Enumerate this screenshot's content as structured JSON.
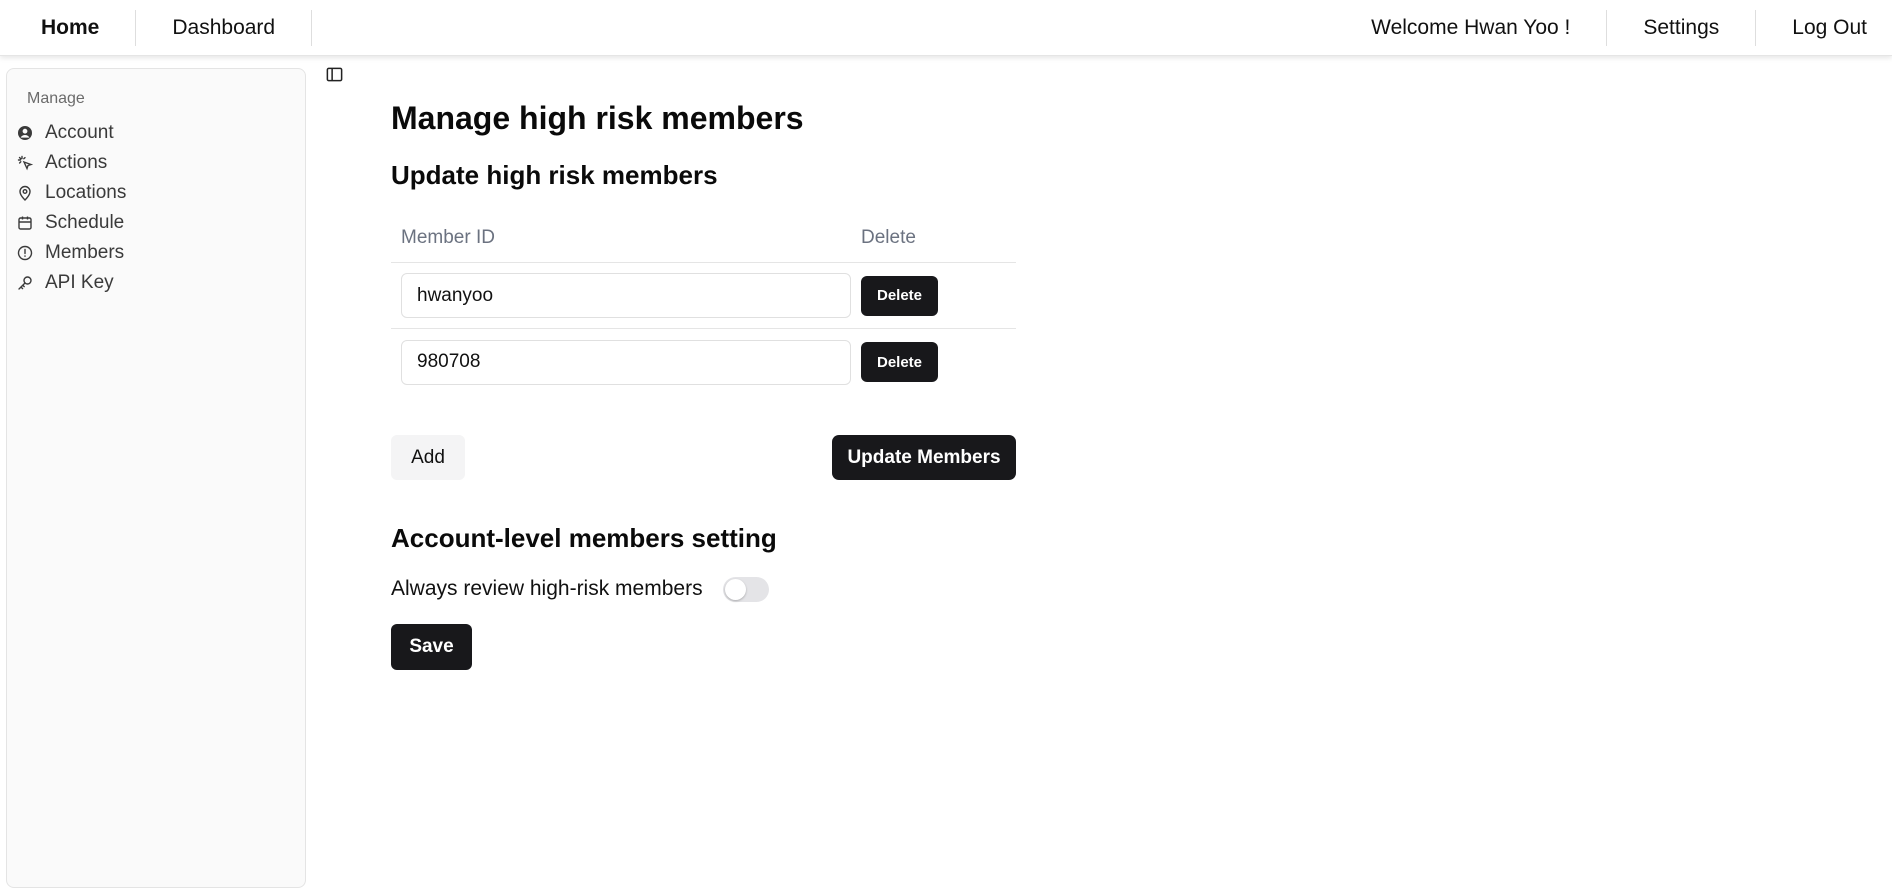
{
  "nav": {
    "home": "Home",
    "dashboard": "Dashboard",
    "welcome": "Welcome Hwan Yoo !",
    "settings": "Settings",
    "logout": "Log Out"
  },
  "sidebar": {
    "group_label": "Manage",
    "items": [
      {
        "label": "Account",
        "icon": "user-circle-icon"
      },
      {
        "label": "Actions",
        "icon": "pointer-click-icon"
      },
      {
        "label": "Locations",
        "icon": "map-pin-icon"
      },
      {
        "label": "Schedule",
        "icon": "calendar-icon"
      },
      {
        "label": "Members",
        "icon": "alert-circle-icon"
      },
      {
        "label": "API Key",
        "icon": "key-icon"
      }
    ],
    "toggle_icon": "sidebar-toggle-icon"
  },
  "main": {
    "page_title": "Manage high risk members",
    "update_section_title": "Update high risk members",
    "table": {
      "headers": [
        "Member ID",
        "Delete"
      ],
      "rows": [
        {
          "member_id": "hwanyoo",
          "delete_label": "Delete"
        },
        {
          "member_id": "980708",
          "delete_label": "Delete"
        }
      ]
    },
    "add_label": "Add",
    "update_label": "Update Members",
    "account_section_title": "Account-level members setting",
    "setting_label": "Always review high-risk members",
    "setting_enabled": false,
    "save_label": "Save"
  },
  "colors": {
    "primary_button": "#18181b",
    "sidebar_bg": "#fafafa",
    "muted_text": "#6b7280"
  }
}
